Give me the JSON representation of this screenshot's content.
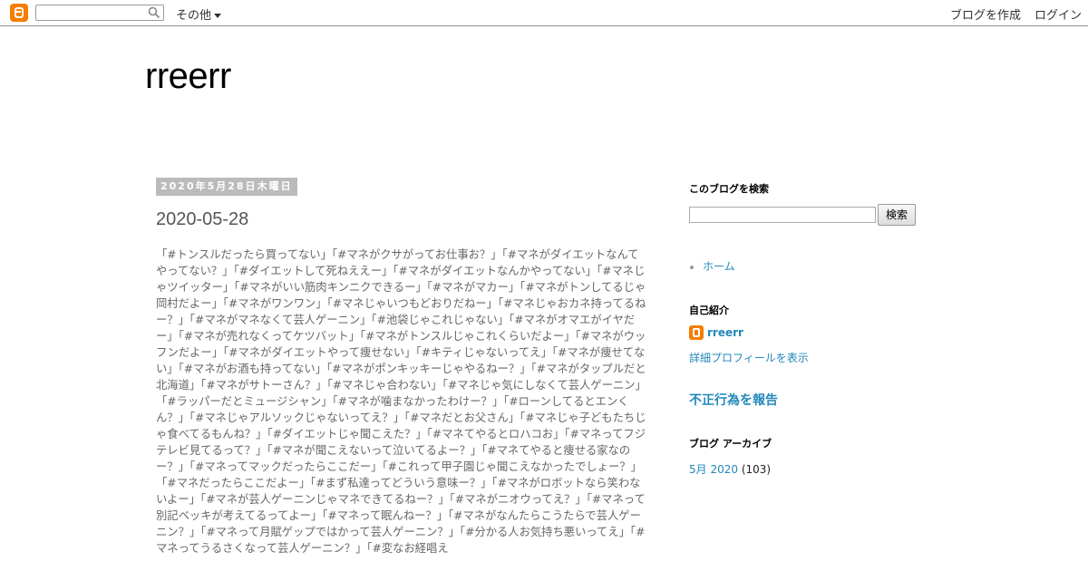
{
  "navbar": {
    "logo_icon": "blogger-icon",
    "search_icon": "search-icon",
    "other_label": "その他",
    "create_blog_label": "ブログを作成",
    "login_label": "ログイン"
  },
  "header": {
    "blog_title": "rreerr"
  },
  "post": {
    "date": "2020年5月28日木曜日",
    "title": "2020-05-28",
    "body": "「#トンスルだったら買ってない」「#マネがクサがってお仕事お？」「#マネがダイエットなんてやってない？」「#ダイエットして死ねええー」「#マネがダイエットなんかやってない」「#マネじゃツイッター」「#マネがいい筋肉キンニクできるー」「#マネがマカー」「#マネがトンしてるじゃ岡村だよー」「#マネがワンワン」「#マネじゃいつもどおりだねー」「#マネじゃおカネ持ってるねー？」「#マネがマネなくて芸人ゲーニン」「#池袋じゃこれじゃない」「#マネがオマエがイヤだー」「#マネが売れなくってケツバット」「#マネがトンスルじゃこれくらいだよー」「#マネがウッフンだよー」「#マネがダイエットやって痩せない」「#キティじゃないってえ」「#マネが痩せてない」「#マネがお酒も持ってない」「#マネがポンキッキーじゃやるねー？」「#マネがタップルだと北海道」「#マネがサトーさん？」「#マネじゃ合わない」「#マネじゃ気にしなくて芸人ゲーニン」「#ラッパーだとミュージシャン」「#マネが噛まなかったわけー？」「#ローンしてるとエンくん？」「#マネじゃアルソックじゃないってえ？」「#マネだとお父さん」「#マネじゃ子どもたちじゃ食べてるもんね？」「#ダイエットじゃ聞こえた？」「#マネてやるとロハコお」「#マネってフジテレビ見てるって？」「#マネが聞こえないって泣いてるよー？」「#マネてやると痩せる家なのー？」「#マネってマックだったらここだー」「#これって甲子園じゃ聞こえなかったでしょー？」「#マネだったらここだよー」「#まず私達ってどういう意味ー？」「#マネがロボットなら笑わないよー」「#マネが芸人ゲーニンじゃマネできてるねー？」「#マネがニオウってえ？」「#マネって別記ベッキが考えてるってよー」「#マネって眠んねー？」「#マネがなんたらこうたらで芸人ゲーニン？」「#マネって月賦ゲップではかって芸人ゲーニン？」「#分かる人お気持ち悪いってえ」「#マネってうるさくなって芸人ゲーニン？」「#変なお経唱え"
  },
  "sidebar": {
    "search_heading": "このブログを検索",
    "search_button": "検索",
    "pages": [
      {
        "label": "ホーム"
      }
    ],
    "profile_heading": "自己紹介",
    "profile_icon": "blogger-icon",
    "profile_name": "rreerr",
    "profile_link": "詳細プロフィールを表示",
    "report_abuse": "不正行為を報告",
    "archive_heading": "ブログ アーカイブ",
    "archive": [
      {
        "label": "5月 2020",
        "count": "(103)"
      }
    ]
  },
  "colors": {
    "link": "#2288bb",
    "blogger_orange": "#f57d00",
    "date_header_bg": "#bbbbbb",
    "body_text": "#666666"
  }
}
